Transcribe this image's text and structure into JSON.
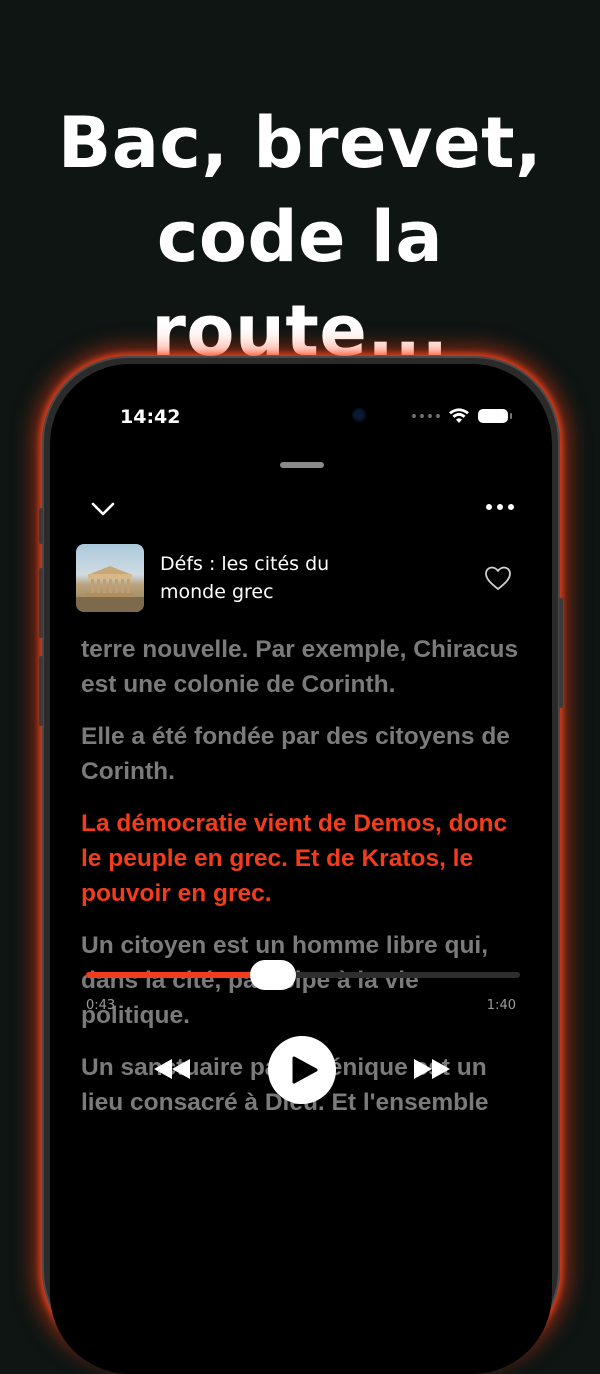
{
  "headline": {
    "line1": "Bac, brevet,",
    "line2": "code la route..."
  },
  "status_bar": {
    "time": "14:42"
  },
  "player": {
    "track_title": "Défs : les cités du monde grec",
    "lyrics": [
      {
        "text": "terre nouvelle. Par exemple, Chiracus est une colonie de Corinth.",
        "active": false
      },
      {
        "text": "Elle a été fondée par des citoyens de Corinth.",
        "active": false
      },
      {
        "text": "La démocratie vient de Demos, donc le peuple en grec. Et de Kratos, le pouvoir en grec.",
        "active": true
      },
      {
        "text": "Un citoyen est un homme libre qui, dans la cité, participe à la vie politique.",
        "active": false
      },
      {
        "text": "Un sanctuaire panhélénique est un lieu consacré à Dieu. Et l'ensemble",
        "active": false
      }
    ],
    "progress": {
      "fraction": 0.43,
      "elapsed": "0:43",
      "total": "1:40"
    },
    "icons": {
      "collapse": "chevron-down-icon",
      "more": "more-horizontal-icon",
      "favorite": "heart-icon",
      "rewind": "rewind-icon",
      "play": "play-icon",
      "forward": "fast-forward-icon"
    }
  },
  "colors": {
    "accent": "#f23c1c",
    "background": "#0e1513",
    "inactive_text": "#7b7b7b"
  }
}
